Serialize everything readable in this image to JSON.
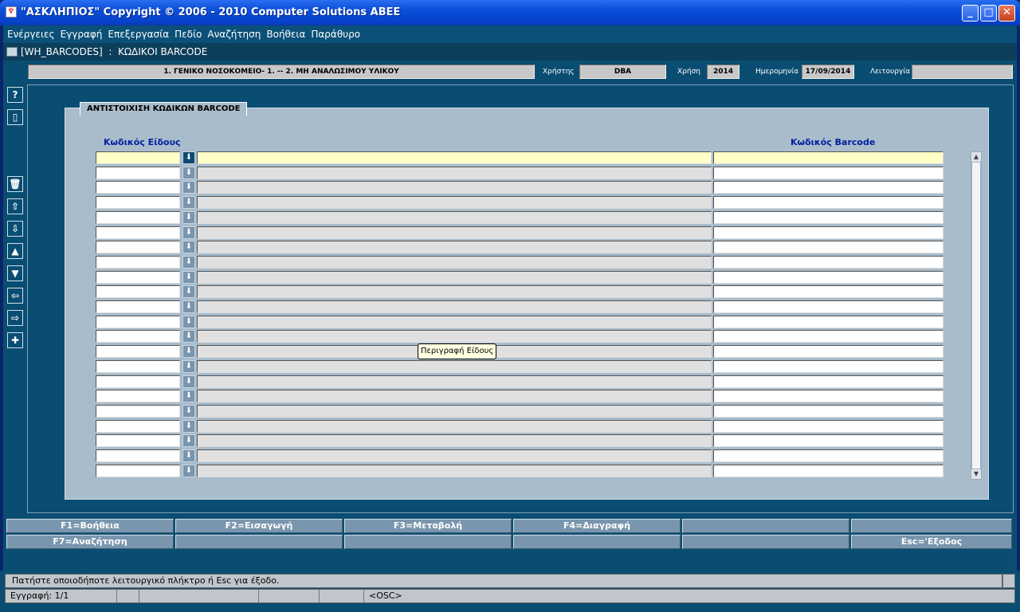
{
  "window": {
    "title": "\"ΑΣΚΛΗΠΙΟΣ\" Copyright © 2006 - 2010 Computer Solutions ΑΒΕΕ",
    "minimize_label": "_",
    "maximize_label": "□",
    "close_label": "✕"
  },
  "menu": [
    "Ενέργειες",
    "Εγγραφή",
    "Επεξεργασία",
    "Πεδίο",
    "Αναζήτηση",
    "Βοήθεια",
    "Παράθυρο"
  ],
  "form": {
    "title": "[WH_BARCODES]  :  ΚΩΔΙΚΟΙ BARCODE"
  },
  "info": {
    "location": "1. ΓΕΝΙΚΟ ΝΟΣΟΚΟΜΕΙΟ- 1. -- 2. ΜΗ ΑΝΑΛΩΣΙΜΟΥ ΥΛΙΚΟΥ",
    "user_label": "Χρήστης",
    "user_value": "DBA",
    "year_label": "Χρήση",
    "year_value": "2014",
    "date_label": "Ημερομηνία",
    "date_value": "17/09/2014",
    "function_label": "Λειτουργία",
    "function_value": ""
  },
  "toolbar_icons": [
    "help-icon",
    "info-icon",
    "delete-icon",
    "first-record-icon",
    "last-record-icon",
    "previous-record-icon",
    "next-record-icon",
    "previous-block-icon",
    "next-block-icon",
    "insert-icon"
  ],
  "toolbar_glyphs": {
    "help": "?",
    "info": "▯",
    "delete": "🗑",
    "first": "⇧",
    "last": "⇩",
    "prev": "▲",
    "next": "▼",
    "left": "⇦",
    "right": "⇨",
    "insert": "✚"
  },
  "panel": {
    "title": "ΑΝΤΙΣΤΟΙΧΙΣΗ ΚΩΔΙΚΩΝ BARCODE",
    "col_item_code": "Κωδικός Είδους",
    "col_barcode": "Κωδικός Barcode",
    "row_count": 22,
    "lov_glyph": "⬇"
  },
  "tooltip": "Περιγραφή Είδους",
  "function_keys": {
    "row1": [
      "F1=Βοήθεια",
      "F2=Εισαγωγή",
      "F3=Μεταβολή",
      "F4=Διαγραφή",
      "",
      ""
    ],
    "row2": [
      "F7=Αναζήτηση",
      "",
      "",
      "",
      "",
      "Esc='Εξοδος"
    ]
  },
  "status": {
    "message": "Πατήστε οποιοδήποτε λειτουργικό πλήκτρο ή Esc για έξοδο.",
    "record": "Εγγραφή: 1/1",
    "mode": "<OSC>"
  },
  "colors": {
    "background": "#0a4d72",
    "panel": "#a9bccb",
    "current_row": "#ffffc8",
    "header_text": "#0020a0"
  }
}
